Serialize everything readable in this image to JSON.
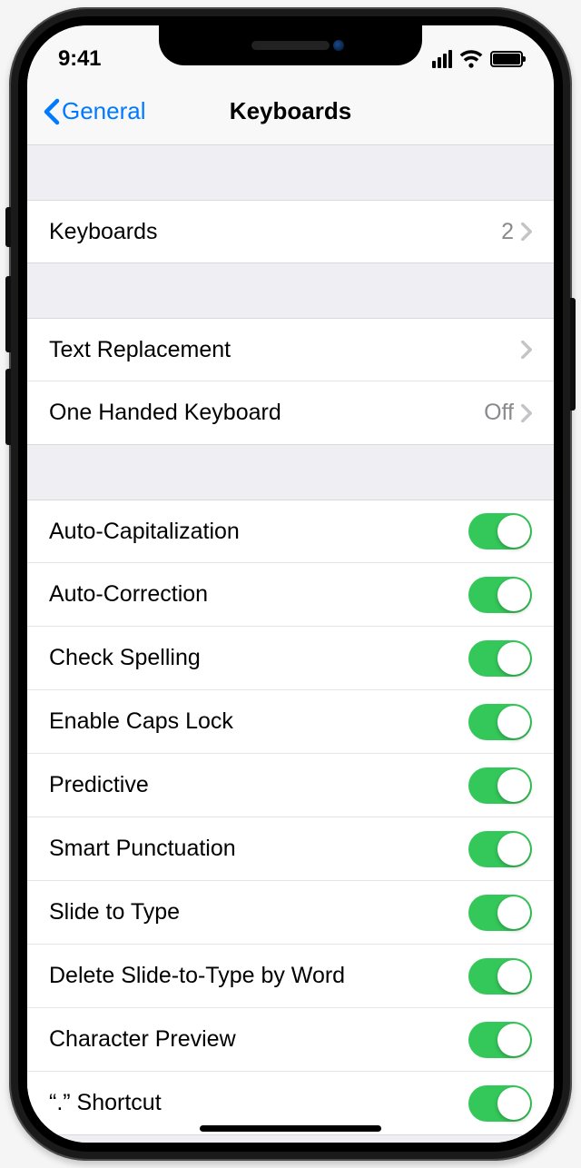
{
  "status": {
    "time": "9:41"
  },
  "nav": {
    "back_label": "General",
    "title": "Keyboards"
  },
  "groups": [
    {
      "rows": [
        {
          "id": "keyboards",
          "label": "Keyboards",
          "value": "2",
          "type": "nav"
        }
      ]
    },
    {
      "rows": [
        {
          "id": "text-replacement",
          "label": "Text Replacement",
          "value": "",
          "type": "nav"
        },
        {
          "id": "one-handed",
          "label": "One Handed Keyboard",
          "value": "Off",
          "type": "nav"
        }
      ]
    },
    {
      "rows": [
        {
          "id": "auto-capitalization",
          "label": "Auto-Capitalization",
          "type": "switch",
          "on": true
        },
        {
          "id": "auto-correction",
          "label": "Auto-Correction",
          "type": "switch",
          "on": true
        },
        {
          "id": "check-spelling",
          "label": "Check Spelling",
          "type": "switch",
          "on": true
        },
        {
          "id": "enable-caps-lock",
          "label": "Enable Caps Lock",
          "type": "switch",
          "on": true
        },
        {
          "id": "predictive",
          "label": "Predictive",
          "type": "switch",
          "on": true
        },
        {
          "id": "smart-punctuation",
          "label": "Smart Punctuation",
          "type": "switch",
          "on": true
        },
        {
          "id": "slide-to-type",
          "label": "Slide to Type",
          "type": "switch",
          "on": true
        },
        {
          "id": "delete-slide-word",
          "label": "Delete Slide-to-Type by Word",
          "type": "switch",
          "on": true
        },
        {
          "id": "character-preview",
          "label": "Character Preview",
          "type": "switch",
          "on": true
        },
        {
          "id": "period-shortcut",
          "label": "“.” Shortcut",
          "type": "switch",
          "on": true
        }
      ]
    }
  ]
}
